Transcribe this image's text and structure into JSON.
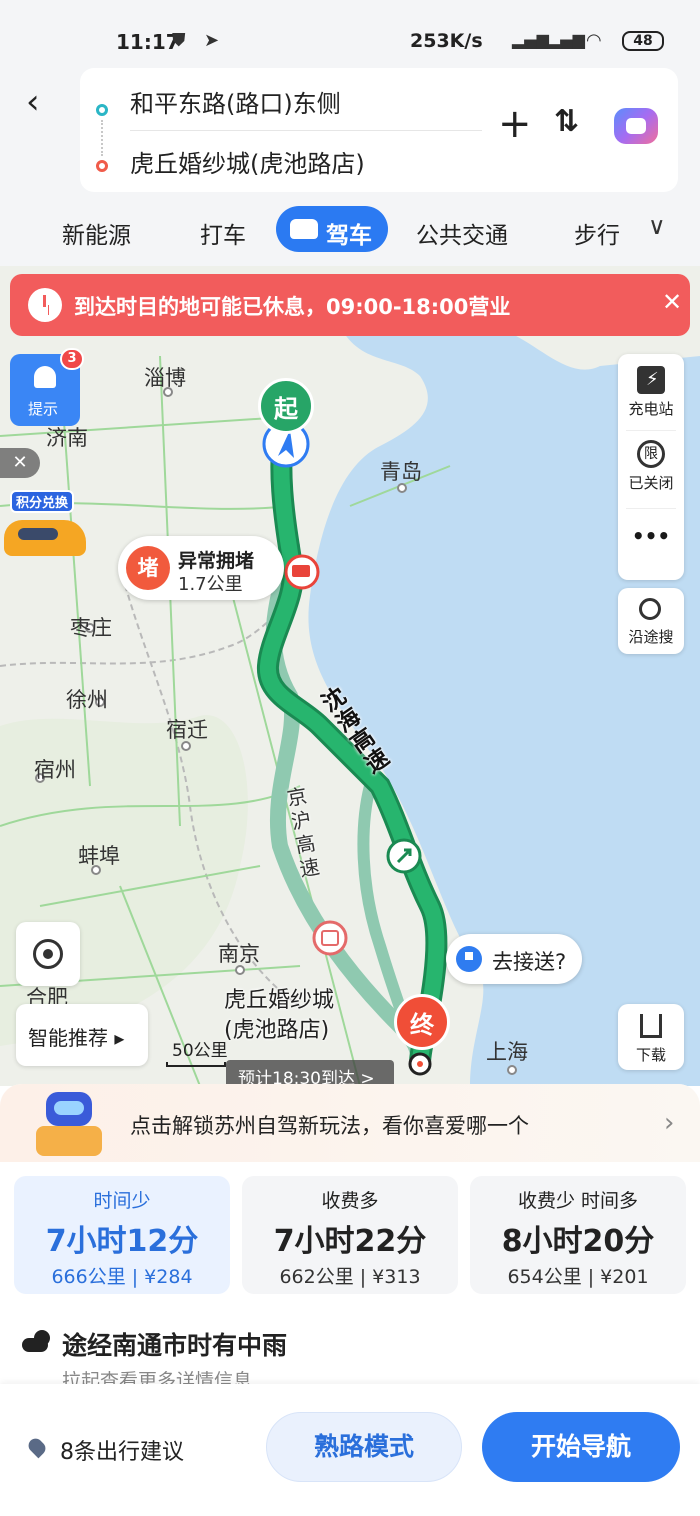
{
  "status_bar": {
    "time": "11:17",
    "speed": "253K/s",
    "battery": "48"
  },
  "search": {
    "origin": "和平东路(路口)东侧",
    "destination": "虎丘婚纱城(虎池路店)"
  },
  "tabs": [
    "新能源",
    "打车",
    "驾车",
    "公共交通",
    "步行"
  ],
  "map": {
    "alert": "到达时目的地可能已休息，09:00-18:00营业",
    "notify_label": "提示",
    "notify_badge": "3",
    "promo_tag": "积分兑换",
    "side_panel": {
      "charging": "充电站",
      "restricted": "已关闭",
      "restricted_glyph": "限",
      "more": "•••",
      "along_search": "沿途搜"
    },
    "jam": {
      "badge": "堵",
      "title": "异常拥堵",
      "distance": "1.7公里"
    },
    "pickup": "去接送?",
    "smart_recommend": "智能推荐 ▸",
    "download": "下载",
    "destination_label_line1": "虎丘婚纱城",
    "destination_label_line2": "(虎池路店)",
    "scale": "50公里",
    "eta": "预计18:30到达 >",
    "start_marker": "起",
    "end_marker": "终",
    "highway_main": "沈海高速",
    "highway_alt": "京沪高速",
    "cities": {
      "zibo": "淄博",
      "jinan": "济南",
      "qingdao": "青岛",
      "zaozhuang": "枣庄",
      "xuzhou": "徐州",
      "suqian": "宿迁",
      "suzhou_ah": "宿州",
      "bengbu": "蚌埠",
      "nanjing": "南京",
      "hefei": "合肥",
      "shanghai": "上海"
    }
  },
  "banner": {
    "text": "点击解锁苏州自驾新玩法，看你喜爱哪一个"
  },
  "routes": [
    {
      "tag": "时间少",
      "duration": "7小时12分",
      "meta": "666公里 | ¥284",
      "selected": true
    },
    {
      "tag": "收费多",
      "duration": "7小时22分",
      "meta": "662公里 | ¥313",
      "selected": false
    },
    {
      "tag": "收费少  时间多",
      "duration": "8小时20分",
      "meta": "654公里 | ¥201",
      "selected": false
    }
  ],
  "weather": {
    "title": "途经南通市时有中雨",
    "subtitle": "拉起查看更多详情信息"
  },
  "footer": {
    "advice": "8条出行建议",
    "familiar_mode": "熟路模式",
    "start_nav": "开始导航"
  },
  "colors": {
    "primary": "#2f7cf2",
    "alert": "#f25c5c",
    "route_main": "#27a567",
    "route_alt": "#8fc9b0",
    "sea": "#bfdcf3"
  }
}
